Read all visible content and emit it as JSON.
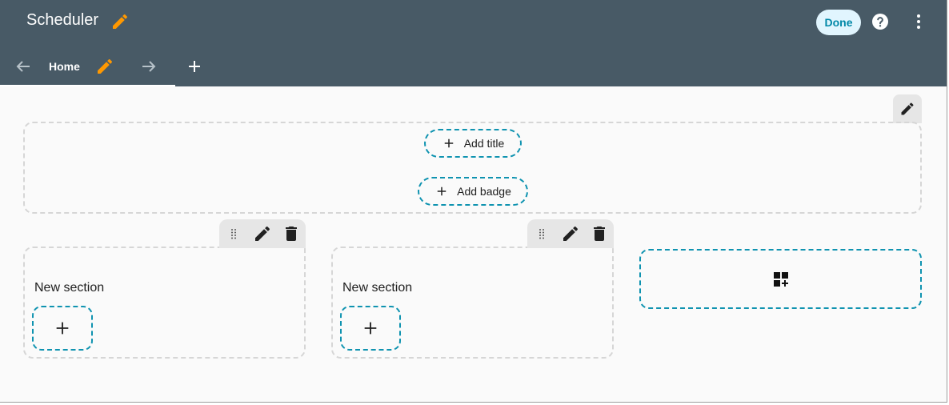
{
  "header": {
    "title": "Scheduler",
    "done_label": "Done",
    "icons": {
      "edit": "pencil-icon",
      "help": "help-circle-icon",
      "more": "dots-vertical-icon"
    },
    "colors": {
      "bar": "#485a66",
      "edit_accent": "#ff9800",
      "done_bg": "#e1f5fe",
      "done_text": "#0288a8"
    }
  },
  "tabs": {
    "items": [
      {
        "label": "Home",
        "selected": true
      }
    ],
    "icons": {
      "left": "arrow-left-icon",
      "edit": "pencil-icon",
      "right": "arrow-right-icon",
      "add": "plus-icon"
    }
  },
  "heading": {
    "add_title_label": "Add title",
    "add_badge_label": "Add badge"
  },
  "sections": [
    {
      "title": "New section"
    },
    {
      "title": "New section"
    }
  ],
  "new_section": {
    "icon": "view-grid-plus-icon"
  },
  "accent_color": "#0f93b0"
}
